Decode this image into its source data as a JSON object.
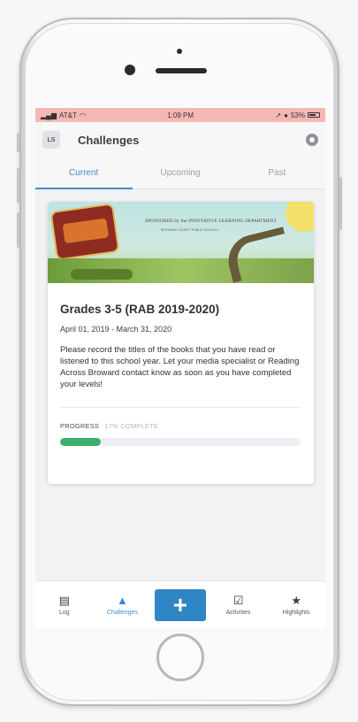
{
  "status": {
    "carrier": "AT&T",
    "time": "1:09 PM",
    "battery": "53%"
  },
  "header": {
    "avatar_initials": "LS",
    "title": "Challenges"
  },
  "tabs": [
    {
      "label": "Current",
      "active": true
    },
    {
      "label": "Upcoming",
      "active": false
    },
    {
      "label": "Past",
      "active": false
    }
  ],
  "card": {
    "banner": {
      "sponsor_line": "SPONSORED by the INNOVATIVE LEARNING DEPARTMENT",
      "sub_line": "BROWARD COUNTY PUBLIC SCHOOLS"
    },
    "title": "Grades 3-5 (RAB 2019-2020)",
    "dates": "April 01, 2019 - March 31, 2020",
    "description": "Please record the titles of the books that you have read or listened to this school year. Let your media specialist or Reading Across Broward contact know as soon as you have completed your levels!",
    "progress_label": "PROGRESS",
    "progress_text": "17% COMPLETE",
    "progress_fraction": 0.17
  },
  "bottom_nav": [
    {
      "label": "Log",
      "icon": "log-icon"
    },
    {
      "label": "Challenges",
      "icon": "challenges-icon",
      "active": true
    },
    {
      "label": "",
      "icon": "plus-icon"
    },
    {
      "label": "Activities",
      "icon": "activities-icon"
    },
    {
      "label": "Highlights",
      "icon": "star-icon"
    }
  ],
  "colors": {
    "accent": "#3f8bd1",
    "progress": "#3bb06a",
    "plus_button": "#2f86c6",
    "status_bar": "#f5b7b3"
  }
}
